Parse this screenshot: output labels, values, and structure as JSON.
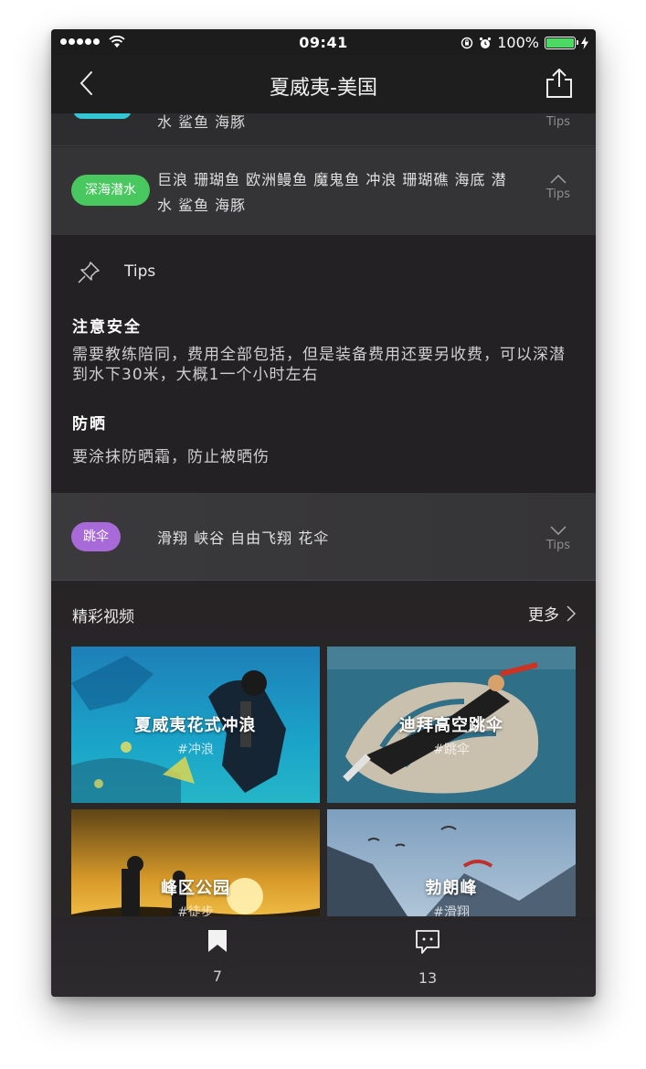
{
  "status_bar": {
    "time": "09:41",
    "battery": "100%"
  },
  "nav": {
    "title": "夏威夷-美国"
  },
  "partial_row": {
    "tags": "水 鲨鱼 海豚",
    "tips_label": "Tips"
  },
  "diving_row": {
    "category": "深海潜水",
    "tags_line1": "巨浪 珊瑚鱼 欧洲鳗鱼 魔鬼鱼 冲浪 珊瑚礁 海底 潜",
    "tags_line2": "水 鲨鱼 海豚",
    "tips_label": "Tips"
  },
  "tips_panel": {
    "header": "Tips",
    "items": [
      {
        "title": "注意安全",
        "body": "需要教练陪同，费用全部包括，但是装备费用还要另收费，可以深潜到水下30米，大概1一个小时左右"
      },
      {
        "title": "防晒",
        "body": "要涂抹防晒霜，防止被晒伤"
      }
    ]
  },
  "parachute_row": {
    "category": "跳伞",
    "tags": "滑翔 峡谷 自由飞翔 花伞",
    "tips_label": "Tips"
  },
  "videos": {
    "section_title": "精彩视频",
    "more_label": "更多",
    "cards": [
      {
        "title": "夏威夷花式冲浪",
        "tag": "#冲浪"
      },
      {
        "title": "迪拜高空跳伞",
        "tag": "#跳伞"
      },
      {
        "title": "峰区公园",
        "tag": "#徒步"
      },
      {
        "title": "勃朗峰",
        "tag": "#滑翔"
      }
    ]
  },
  "tab_bar": {
    "bookmark_count": "7",
    "comment_count": "13"
  },
  "colors": {
    "diving_pill": "#48c85e",
    "parachute_pill": "#a86ad8",
    "partial_pill": "#35c6d6",
    "battery": "#4cd964"
  }
}
